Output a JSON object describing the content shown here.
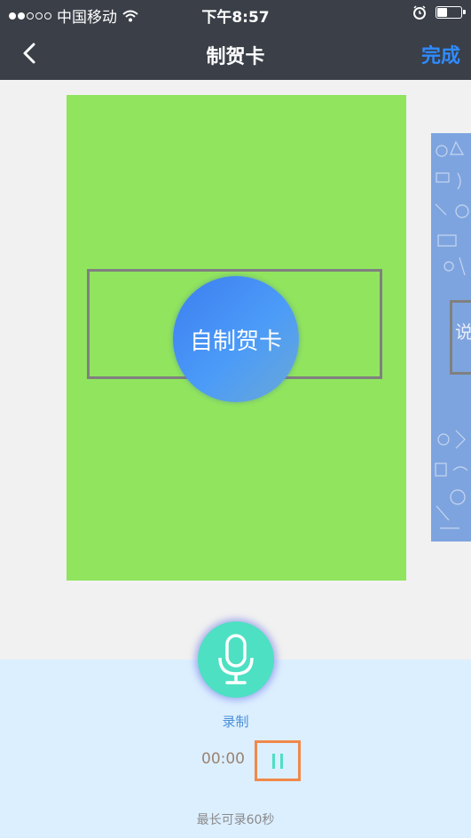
{
  "status_bar": {
    "carrier": "中国移动",
    "time": "下午8:57",
    "battery_level": 0.45
  },
  "nav": {
    "title": "制贺卡",
    "done_label": "完成"
  },
  "cards": {
    "main_button_label": "自制贺卡",
    "main_card_color": "#90e45e",
    "next_card_visible_char": "说"
  },
  "recorder": {
    "record_label": "录制",
    "timer": "00:00",
    "max_hint": "最长可录60秒"
  },
  "colors": {
    "nav_bg": "#3a3f48",
    "accent_blue": "#2f8bff",
    "mic_teal": "#4ee0c2",
    "highlight_orange": "#f0894a",
    "panel_bg": "#dcefff"
  },
  "icons": [
    "back-chevron-icon",
    "wifi-icon",
    "alarm-clock-icon",
    "battery-icon",
    "microphone-icon",
    "pause-icon"
  ]
}
